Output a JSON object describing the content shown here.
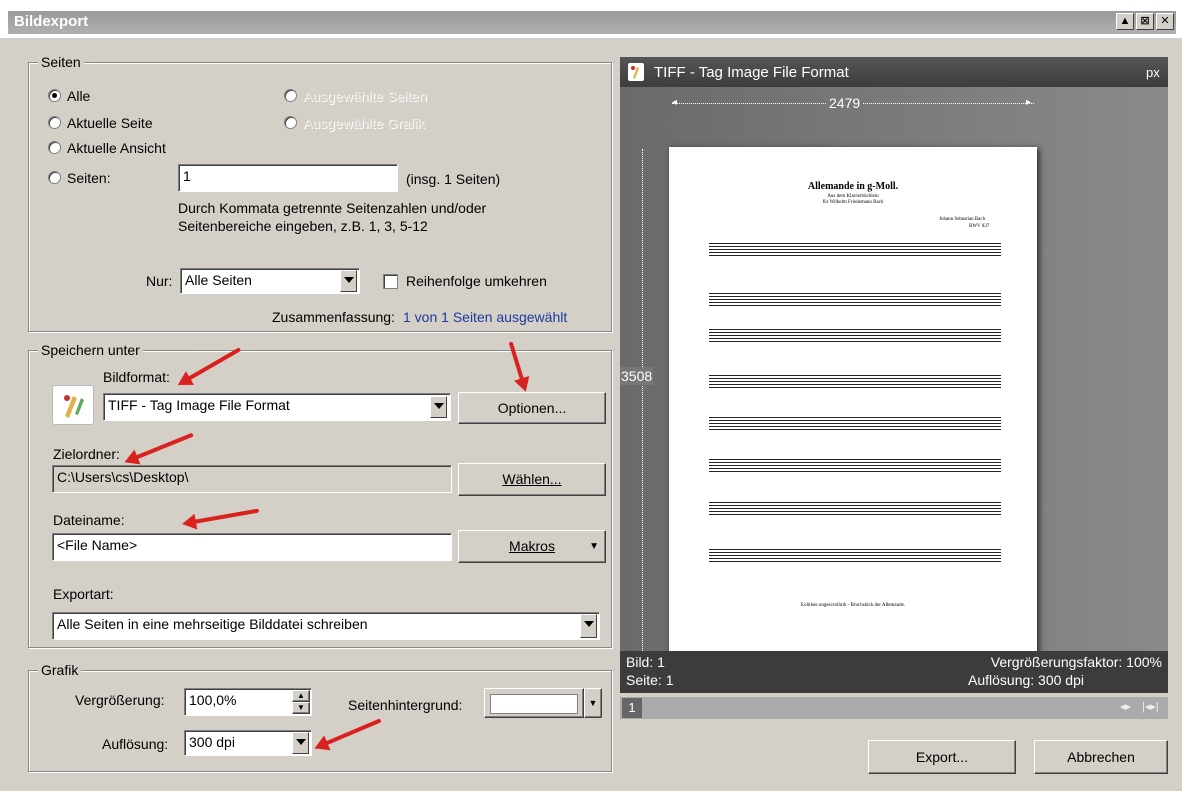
{
  "window": {
    "title": "Bildexport",
    "controls": [
      "▲",
      "⊠",
      "✕"
    ]
  },
  "pages_group": {
    "label": "Seiten",
    "radios": {
      "all": "Alle",
      "current_page": "Aktuelle Seite",
      "current_view": "Aktuelle Ansicht",
      "pages": "Seiten:",
      "selected_pages": "Ausgewählte Seiten",
      "selected_graphic": "Ausgewählte Grafik"
    },
    "pages_value": "1",
    "pages_total": "(insg. 1 Seiten)",
    "hint_line1": "Durch Kommata getrennte Seitenzahlen und/oder",
    "hint_line2": "Seitenbereiche eingeben, z.B. 1, 3, 5-12",
    "only_label": "Nur:",
    "only_value": "Alle Seiten",
    "reverse_label": "Reihenfolge umkehren",
    "summary_prefix": "Zusammenfassung:",
    "summary_value": "1 von 1 Seiten ausgewählt"
  },
  "save_group": {
    "label": "Speichern unter",
    "format_label": "Bildformat:",
    "format_value": "TIFF - Tag Image File Format",
    "options_button": "Optionen...",
    "folder_label": "Zielordner:",
    "folder_value": "C:\\Users\\cs\\Desktop\\",
    "choose_button": "Wählen...",
    "filename_label": "Dateiname:",
    "filename_value": "<File Name>",
    "macros_button": "Makros",
    "export_type_label": "Exportart:",
    "export_type_value": "Alle Seiten in eine mehrseitige Bilddatei schreiben"
  },
  "graphic_group": {
    "label": "Grafik",
    "zoom_label": "Vergrößerung:",
    "zoom_value": "100,0%",
    "resolution_label": "Auflösung:",
    "resolution_value": "300 dpi",
    "background_label": "Seitenhintergrund:"
  },
  "preview": {
    "format": "TIFF - Tag Image File Format",
    "unit": "px",
    "width": "2479",
    "height": "3508",
    "score_title": "Allemande in g-Moll.",
    "score_subtitle1": "Aus dem Klavierbüchlein",
    "score_subtitle2": "für Wilhelm Friedemann Bach",
    "composer": "Johann Sebastian Bach",
    "bwv": "BWV 837",
    "footnote": "Eolithée ungesvrolhtih - Bruchstück der Allemande.",
    "image_label": "Bild: 1",
    "page_label": "Seite: 1",
    "zoom_factor": "Vergrößerungsfaktor: 100%",
    "resolution": "Auflösung: 300 dpi",
    "page_tab": "1"
  },
  "buttons": {
    "export": "Export...",
    "cancel": "Abbrechen"
  },
  "colors": {
    "arrow": "#d9221f",
    "summary_value": "#1d3a9e"
  }
}
